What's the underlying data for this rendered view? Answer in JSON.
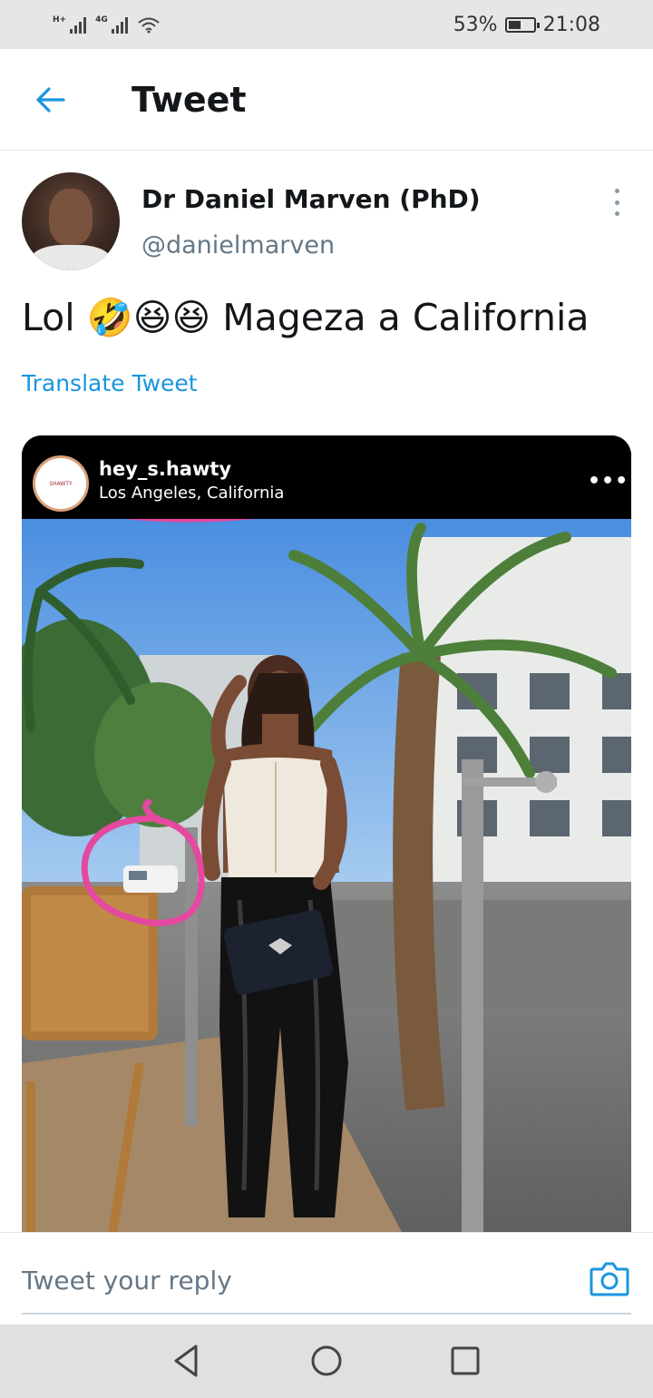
{
  "status_bar": {
    "signal1_label": "H+",
    "signal2_label": "4G",
    "battery": "53%",
    "time": "21:08"
  },
  "header": {
    "title": "Tweet"
  },
  "tweet": {
    "author_name": "Dr Daniel Marven (PhD)",
    "author_handle": "@danielmarven",
    "text_prefix": "Lol",
    "emojis": "🤣😆😆",
    "text_suffix": "Mageza a California",
    "translate_label": "Translate Tweet"
  },
  "media": {
    "ig_username": "hey_s.hawty",
    "ig_location": "Los Angeles, California",
    "ig_more": "•••",
    "ig_avatar_text": "SHAWTY"
  },
  "reply": {
    "placeholder": "Tweet your reply"
  },
  "colors": {
    "accent": "#1b95e0",
    "text_primary": "#14171a",
    "text_secondary": "#657786",
    "annotation": "#e5489f"
  }
}
